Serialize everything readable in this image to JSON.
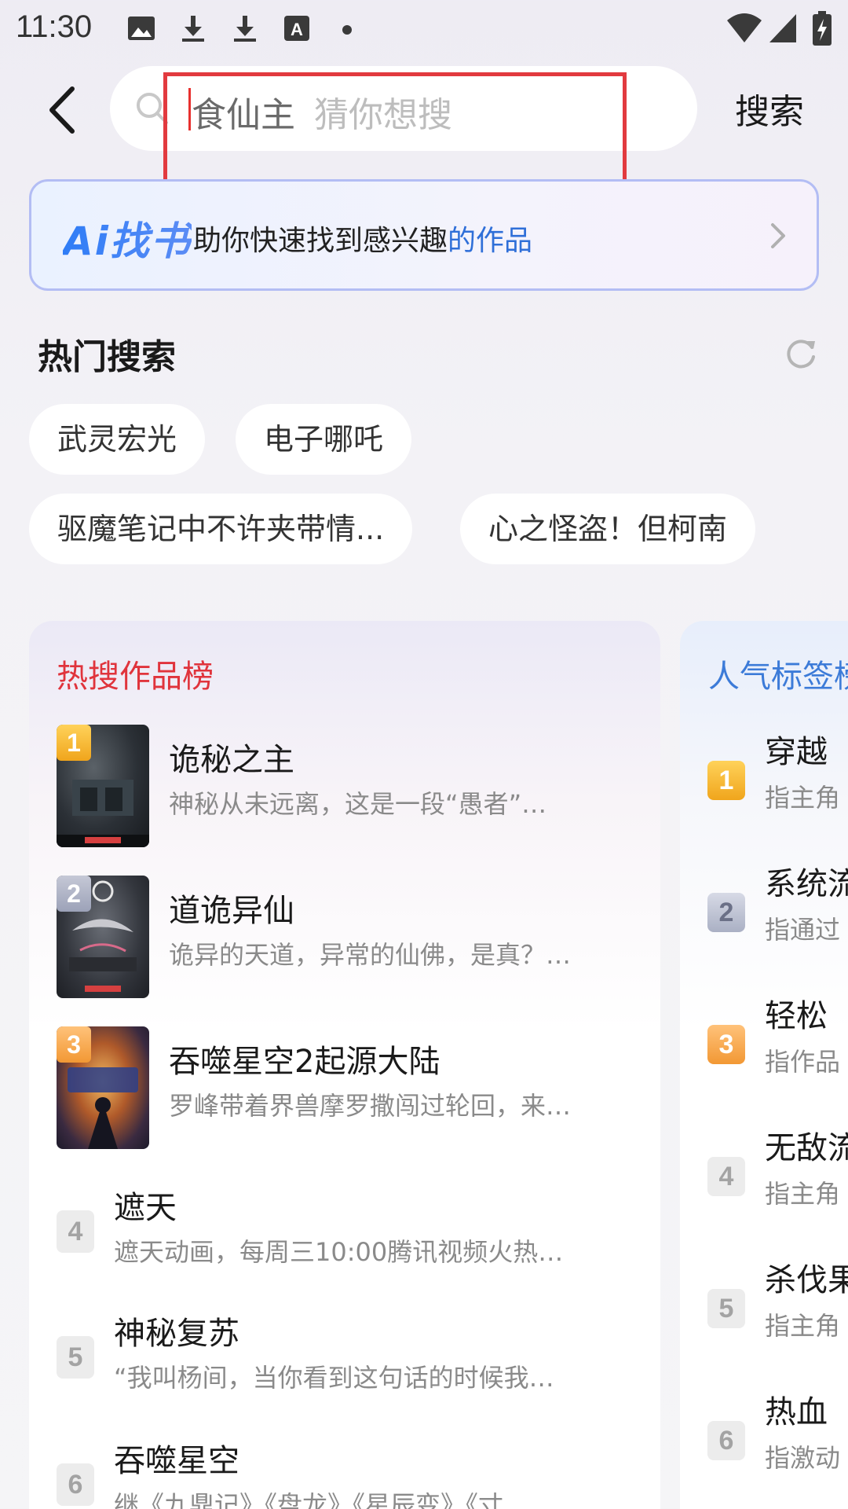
{
  "status_bar": {
    "time": "11:30",
    "icons": [
      "image-icon",
      "download-icon",
      "download-icon",
      "font-icon",
      "dot-icon",
      "wifi-icon",
      "signal-icon",
      "battery-icon"
    ]
  },
  "search": {
    "value": "食仙主",
    "placeholder": "猜你想搜",
    "button_label": "搜索"
  },
  "ai_banner": {
    "logo": "Ai找书",
    "text_prefix": "助你快速找到感兴趣",
    "text_accent": "的作品"
  },
  "hot_search": {
    "title": "热门搜索",
    "tags": [
      "武灵宏光",
      "电子哪吒",
      "驱魔笔记中不许夹带情...",
      "心之怪盗！但柯南"
    ]
  },
  "hot_works": {
    "title": "热搜作品榜",
    "items": [
      {
        "rank": "1",
        "title": "诡秘之主",
        "desc": "神秘从未远离，这是一段“愚者”…"
      },
      {
        "rank": "2",
        "title": "道诡异仙",
        "desc": "诡异的天道，异常的仙佛，是真？…"
      },
      {
        "rank": "3",
        "title": "吞噬星空2起源大陆",
        "desc": "罗峰带着界兽摩罗撒闯过轮回，来…"
      },
      {
        "rank": "4",
        "title": "遮天",
        "desc": "遮天动画，每周三10:00腾讯视频火热…"
      },
      {
        "rank": "5",
        "title": "神秘复苏",
        "desc": "“我叫杨间，当你看到这句话的时候我…"
      },
      {
        "rank": "6",
        "title": "吞噬星空",
        "desc": "继《九鼎记》《盘龙》《星辰变》《寸…"
      }
    ]
  },
  "popular_tags": {
    "title": "人气标签榜",
    "items": [
      {
        "rank": "1",
        "name": "穿越",
        "desc": "指主角"
      },
      {
        "rank": "2",
        "name": "系统流",
        "desc": "指通过"
      },
      {
        "rank": "3",
        "name": "轻松",
        "desc": "指作品"
      },
      {
        "rank": "4",
        "name": "无敌流",
        "desc": "指主角"
      },
      {
        "rank": "5",
        "name": "杀伐果",
        "desc": "指主角"
      },
      {
        "rank": "6",
        "name": "热血",
        "desc": "指激动"
      }
    ]
  },
  "colors": {
    "accent_red": "#e0343c",
    "accent_blue": "#3c7bd8",
    "highlight_box": "#e23a3f"
  }
}
